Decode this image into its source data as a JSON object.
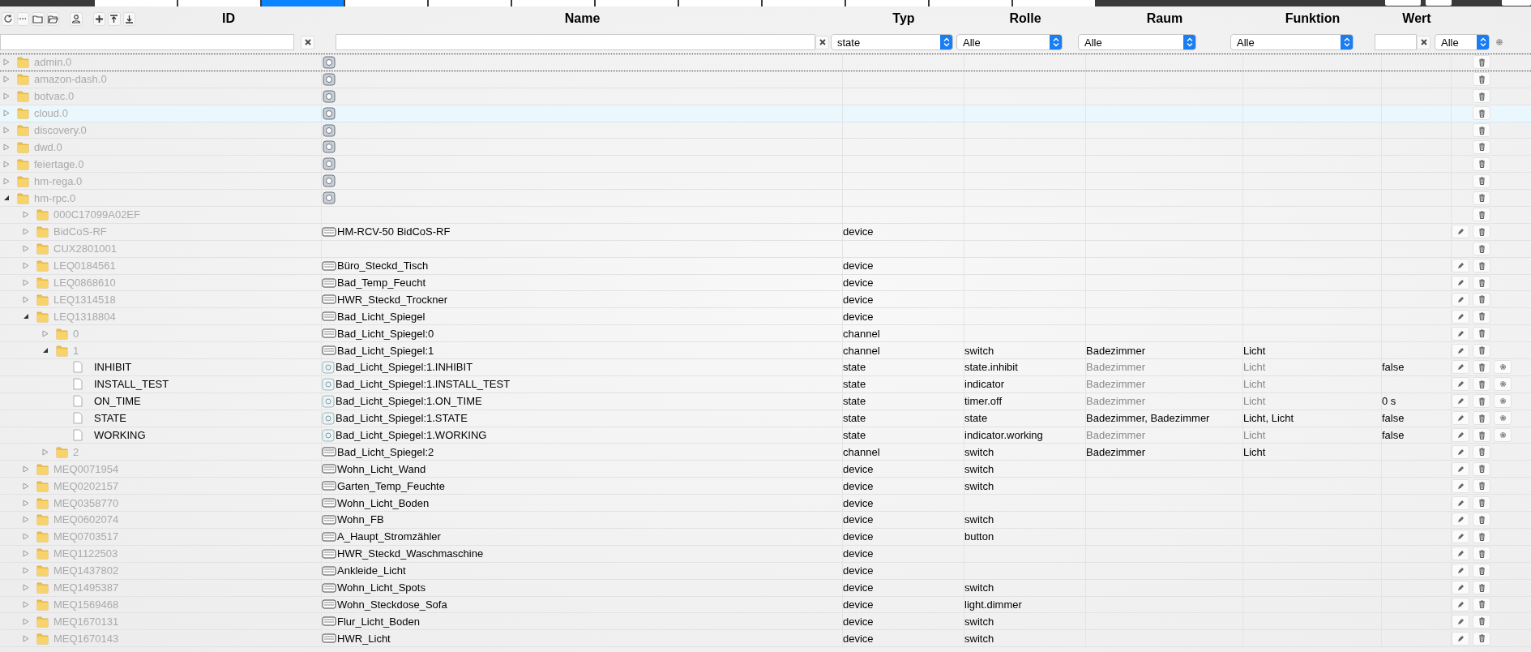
{
  "tabs": [
    {
      "selected": false
    },
    {
      "selected": false
    },
    {
      "selected": true
    },
    {
      "selected": false
    },
    {
      "selected": false
    },
    {
      "selected": false
    },
    {
      "selected": false
    },
    {
      "selected": false
    },
    {
      "selected": false
    },
    {
      "selected": false
    },
    {
      "selected": false
    },
    {
      "selected": false
    }
  ],
  "columns": [
    "ID",
    "Name",
    "Typ",
    "Rolle",
    "Raum",
    "Funktion",
    "Wert"
  ],
  "filters": {
    "typ": "state",
    "rolle": "Alle",
    "raum": "Alle",
    "funktion": "Alle",
    "wert": "Alle"
  },
  "tree": [
    {
      "id": "admin.0",
      "kind": "folder",
      "expanded": false,
      "selected": false,
      "icon": true
    },
    {
      "id": "amazon-dash.0",
      "kind": "folder",
      "expanded": false,
      "selected": false,
      "icon": true
    },
    {
      "id": "botvac.0",
      "kind": "folder",
      "expanded": false,
      "selected": false,
      "icon": true
    },
    {
      "id": "cloud.0",
      "kind": "folder",
      "expanded": false,
      "selected": true,
      "icon": true
    },
    {
      "id": "discovery.0",
      "kind": "folder",
      "expanded": false,
      "selected": false,
      "icon": true
    },
    {
      "id": "dwd.0",
      "kind": "folder",
      "expanded": false,
      "selected": false,
      "icon": true
    },
    {
      "id": "feiertage.0",
      "kind": "folder",
      "expanded": false,
      "selected": false,
      "icon": true
    },
    {
      "id": "hm-rega.0",
      "kind": "folder",
      "expanded": false,
      "selected": false,
      "icon": true
    },
    {
      "id": "hm-rpc.0",
      "kind": "folder",
      "expanded": true,
      "selected": false,
      "icon": true,
      "children": [
        {
          "id": "000C17099A02EF",
          "kind": "folder",
          "expanded": false,
          "selected": false,
          "icon": false
        },
        {
          "id": "BidCoS-RF",
          "kind": "folder",
          "expanded": false,
          "selected": false,
          "icon": true,
          "name": "HM-RCV-50 BidCoS-RF",
          "type": "device"
        },
        {
          "id": "CUX2801001",
          "kind": "folder",
          "expanded": false,
          "selected": false,
          "icon": false
        },
        {
          "id": "LEQ0184561",
          "kind": "folder",
          "expanded": false,
          "selected": false,
          "icon": true,
          "name": "Büro_Steckd_Tisch",
          "type": "device"
        },
        {
          "id": "LEQ0868610",
          "kind": "folder",
          "expanded": false,
          "selected": false,
          "icon": true,
          "name": "Bad_Temp_Feucht",
          "type": "device"
        },
        {
          "id": "LEQ1314518",
          "kind": "folder",
          "expanded": false,
          "selected": false,
          "icon": true,
          "name": "HWR_Steckd_Trockner",
          "type": "device"
        },
        {
          "id": "LEQ1318804",
          "kind": "folder",
          "expanded": true,
          "selected": false,
          "icon": true,
          "name": "Bad_Licht_Spiegel",
          "type": "device",
          "children": [
            {
              "id": "0",
              "kind": "folder",
              "expanded": false,
              "selected": false,
              "icon": true,
              "name": "Bad_Licht_Spiegel:0",
              "type": "channel"
            },
            {
              "id": "1",
              "kind": "folder",
              "expanded": true,
              "selected": false,
              "icon": true,
              "name": "Bad_Licht_Spiegel:1",
              "type": "channel",
              "role": "switch",
              "room": "Badezimmer",
              "function": "Licht",
              "inherited": false,
              "children": [
                {
                  "id": "INHIBIT",
                  "kind": "state",
                  "selected": false,
                  "icon": true,
                  "name": "Bad_Licht_Spiegel:1.INHIBIT",
                  "type": "state",
                  "role": "state.inhibit",
                  "room": "Badezimmer",
                  "function": "Licht",
                  "inherited": true,
                  "value": "false"
                },
                {
                  "id": "INSTALL_TEST",
                  "kind": "state",
                  "selected": false,
                  "icon": true,
                  "name": "Bad_Licht_Spiegel:1.INSTALL_TEST",
                  "type": "state",
                  "role": "indicator",
                  "room": "Badezimmer",
                  "function": "Licht",
                  "inherited": true
                },
                {
                  "id": "ON_TIME",
                  "kind": "state",
                  "selected": false,
                  "icon": true,
                  "name": "Bad_Licht_Spiegel:1.ON_TIME",
                  "type": "state",
                  "role": "timer.off",
                  "room": "Badezimmer",
                  "function": "Licht",
                  "inherited": true,
                  "value": "0 s"
                },
                {
                  "id": "STATE",
                  "kind": "state",
                  "selected": false,
                  "icon": true,
                  "name": "Bad_Licht_Spiegel:1.STATE",
                  "type": "state",
                  "role": "state",
                  "room": "Badezimmer, Badezimmer",
                  "function": "Licht, Licht",
                  "inherited": false,
                  "value": "false"
                },
                {
                  "id": "WORKING",
                  "kind": "state",
                  "selected": false,
                  "icon": true,
                  "name": "Bad_Licht_Spiegel:1.WORKING",
                  "type": "state",
                  "role": "indicator.working",
                  "room": "Badezimmer",
                  "function": "Licht",
                  "inherited": true,
                  "value": "false"
                }
              ]
            },
            {
              "id": "2",
              "kind": "folder",
              "expanded": false,
              "selected": false,
              "icon": true,
              "name": "Bad_Licht_Spiegel:2",
              "type": "channel",
              "role": "switch",
              "room": "Badezimmer",
              "function": "Licht",
              "inherited": false
            }
          ]
        },
        {
          "id": "MEQ0071954",
          "kind": "folder",
          "expanded": false,
          "selected": false,
          "icon": true,
          "name": "Wohn_Licht_Wand",
          "type": "device",
          "role": "switch"
        },
        {
          "id": "MEQ0202157",
          "kind": "folder",
          "expanded": false,
          "selected": false,
          "icon": true,
          "name": "Garten_Temp_Feuchte",
          "type": "device",
          "role": "switch"
        },
        {
          "id": "MEQ0358770",
          "kind": "folder",
          "expanded": false,
          "selected": false,
          "icon": true,
          "name": "Wohn_Licht_Boden",
          "type": "device"
        },
        {
          "id": "MEQ0602074",
          "kind": "folder",
          "expanded": false,
          "selected": false,
          "icon": true,
          "name": "Wohn_FB",
          "type": "device",
          "role": "switch"
        },
        {
          "id": "MEQ0703517",
          "kind": "folder",
          "expanded": false,
          "selected": false,
          "icon": true,
          "name": "A_Haupt_Stromzähler",
          "type": "device",
          "role": "button"
        },
        {
          "id": "MEQ1122503",
          "kind": "folder",
          "expanded": false,
          "selected": false,
          "icon": true,
          "name": "HWR_Steckd_Waschmaschine",
          "type": "device"
        },
        {
          "id": "MEQ1437802",
          "kind": "folder",
          "expanded": false,
          "selected": false,
          "icon": true,
          "name": "Ankleide_Licht",
          "type": "device"
        },
        {
          "id": "MEQ1495387",
          "kind": "folder",
          "expanded": false,
          "selected": false,
          "icon": true,
          "name": "Wohn_Licht_Spots",
          "type": "device",
          "role": "switch"
        },
        {
          "id": "MEQ1569468",
          "kind": "folder",
          "expanded": false,
          "selected": false,
          "icon": true,
          "name": "Wohn_Steckdose_Sofa",
          "type": "device",
          "role": "light.dimmer"
        },
        {
          "id": "MEQ1670131",
          "kind": "folder",
          "expanded": false,
          "selected": false,
          "icon": true,
          "name": "Flur_Licht_Boden",
          "type": "device",
          "role": "switch"
        },
        {
          "id": "MEQ1670143",
          "kind": "folder",
          "expanded": false,
          "selected": false,
          "icon": true,
          "name": "HWR_Licht",
          "type": "device",
          "role": "switch"
        }
      ]
    }
  ]
}
